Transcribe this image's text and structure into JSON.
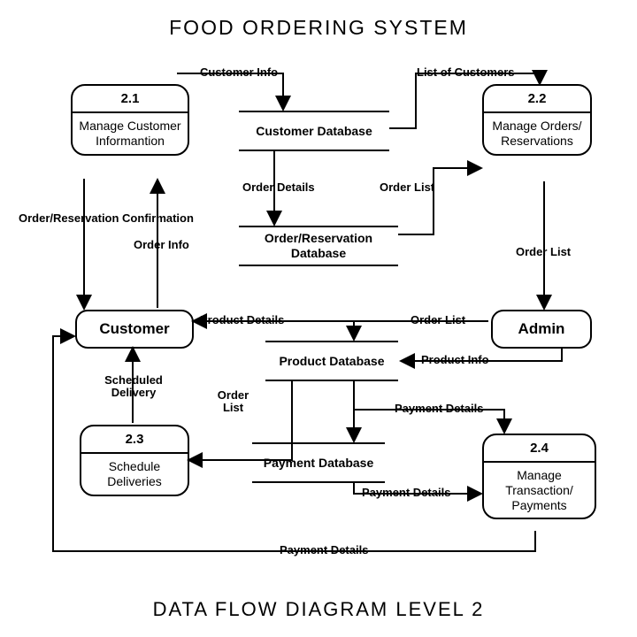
{
  "title": "FOOD ORDERING SYSTEM",
  "subtitle": "DATA FLOW DIAGRAM LEVEL 2",
  "processes": {
    "p21": {
      "num": "2.1",
      "label": "Manage Customer Informantion"
    },
    "p22": {
      "num": "2.2",
      "label": "Manage Orders/ Reservations"
    },
    "p23": {
      "num": "2.3",
      "label": "Schedule Deliveries"
    },
    "p24": {
      "num": "2.4",
      "label": "Manage Transaction/ Payments"
    }
  },
  "entities": {
    "customer": "Customer",
    "admin": "Admin"
  },
  "stores": {
    "customer_db": "Customer Database",
    "order_db": "Order/Reservation Database",
    "product_db": "Product Database",
    "payment_db": "Payment Database"
  },
  "flows": {
    "customer_info": "Customer Info",
    "list_customers": "List of Customers",
    "order_res_conf": "Order/Reservation Confirmation",
    "order_info": "Order Info",
    "order_details": "Order Details",
    "order_list": "Order List",
    "order_list2": "Order List",
    "order_list3": "Order List",
    "order_list4": "Order List",
    "product_details": "Product Details",
    "product_info": "Product Info",
    "scheduled_delivery": "Scheduled Delivery",
    "payment_details": "Payment Details",
    "payment_details2": "Payment Details",
    "payment_details3": "Payment Details"
  }
}
